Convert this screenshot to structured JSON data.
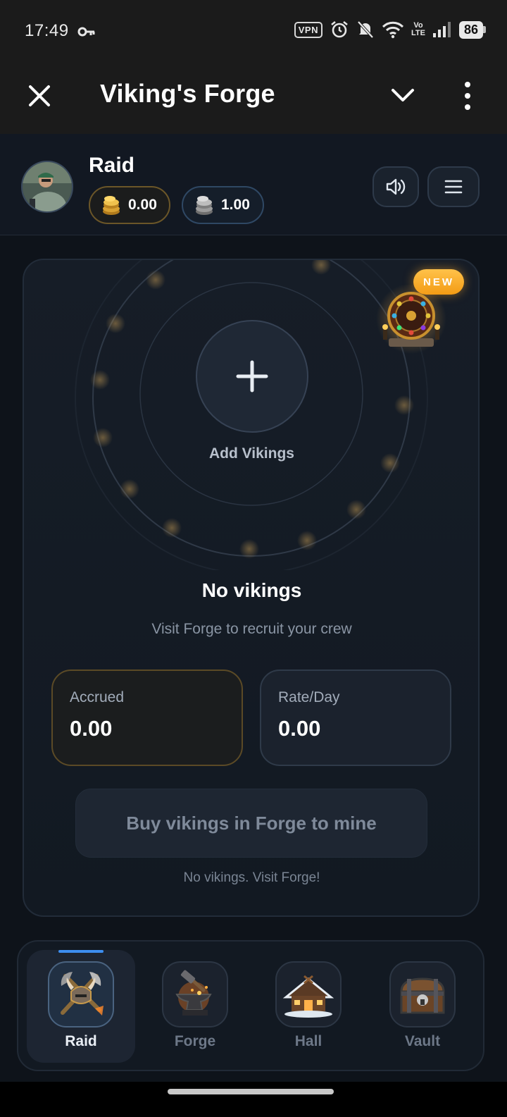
{
  "status_bar": {
    "time": "17:49",
    "vpn_label": "VPN",
    "volte_label": "Vo\nLTE",
    "battery": "86",
    "icons": [
      "key-icon",
      "vpn-icon",
      "alarm-icon",
      "mute-icon",
      "wifi-icon",
      "volte-icon",
      "signal-icon",
      "battery-icon"
    ]
  },
  "app_bar": {
    "title": "Viking's Forge",
    "icons": [
      "close-icon",
      "chevron-down-icon",
      "more-vertical-icon"
    ]
  },
  "header": {
    "title": "Raid",
    "gold_balance": "0.00",
    "silver_balance": "1.00",
    "icons": [
      "avatar",
      "gold-coins-icon",
      "silver-coins-icon",
      "sound-icon",
      "menu-icon"
    ]
  },
  "main": {
    "new_badge": "NEW",
    "add_label": "Add Vikings",
    "empty_title": "No vikings",
    "empty_subtitle": "Visit Forge to recruit your crew",
    "stats": [
      {
        "label": "Accrued",
        "value": "0.00"
      },
      {
        "label": "Rate/Day",
        "value": "0.00"
      }
    ],
    "buy_button": "Buy vikings in Forge to mine",
    "hint": "No vikings. Visit Forge!",
    "icons": [
      "plus-icon",
      "fortune-wheel-icon"
    ]
  },
  "nav": {
    "items": [
      {
        "label": "Raid",
        "active": true,
        "icon": "raid-icon"
      },
      {
        "label": "Forge",
        "active": false,
        "icon": "anvil-icon"
      },
      {
        "label": "Hall",
        "active": false,
        "icon": "hall-icon"
      },
      {
        "label": "Vault",
        "active": false,
        "icon": "chest-icon"
      }
    ]
  },
  "colors": {
    "background": "#0e131a",
    "accent_gold": "#f39b14",
    "active_indicator": "#3d8ef0"
  }
}
